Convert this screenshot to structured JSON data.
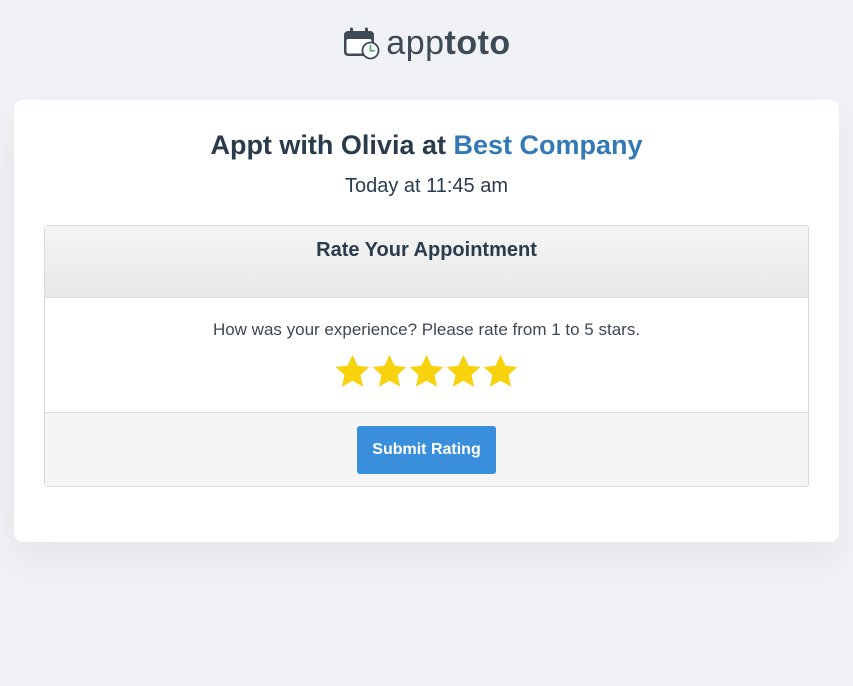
{
  "brand": {
    "logo_icon": "calendar-clock-icon",
    "name_light": "app",
    "name_bold": "toto"
  },
  "appointment": {
    "title_prefix": "Appt with Olivia at",
    "company": "Best Company",
    "when": "Today at 11:45 am"
  },
  "rating": {
    "heading": "Rate Your Appointment",
    "prompt": "How was your experience? Please rate from 1 to 5 stars.",
    "stars_total": 5,
    "stars_selected": 5,
    "star_color": "#f8d20c",
    "submit_label": "Submit Rating"
  },
  "colors": {
    "accent": "#3a8fdd",
    "company_link": "#3379b5",
    "background": "#f0f2f5"
  }
}
